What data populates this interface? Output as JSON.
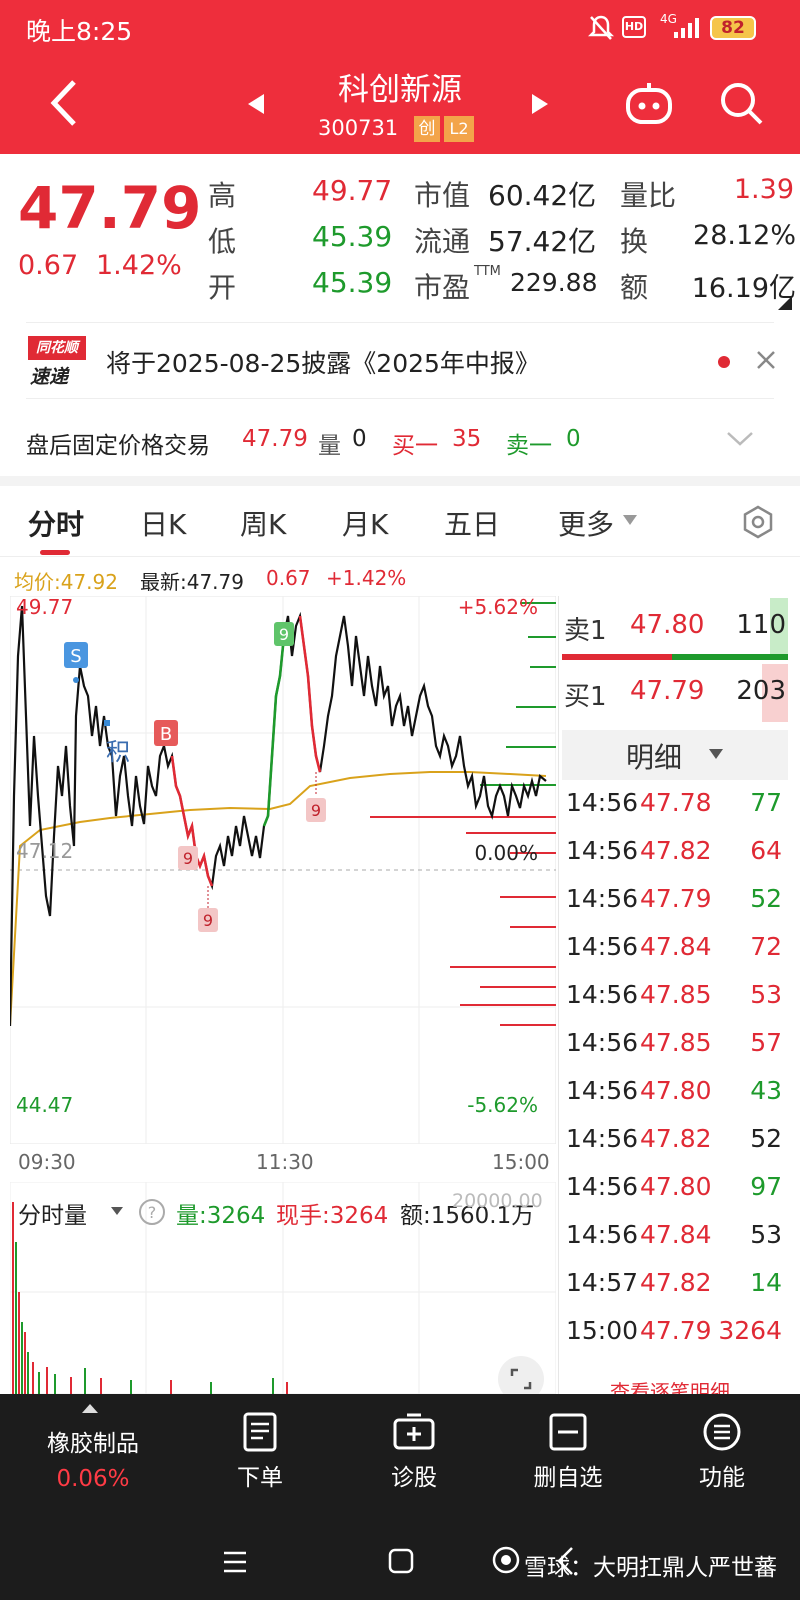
{
  "status": {
    "time": "晚上8:25",
    "battery": "82",
    "net": "4G",
    "hd": "HD"
  },
  "header": {
    "title": "科创新源",
    "code": "300731",
    "tag1": "创",
    "tag2": "L2"
  },
  "quote": {
    "price": "47.79",
    "change": "0.67",
    "pct": "1.42%",
    "labels": {
      "high": "高",
      "low": "低",
      "open": "开",
      "mcap": "市值",
      "float": "流通",
      "pe": "市盈",
      "pe_sup": "TTM",
      "vr": "量比",
      "turn": "换",
      "amt": "额"
    },
    "high": "49.77",
    "low": "45.39",
    "open": "45.39",
    "mcap": "60.42亿",
    "float": "57.42亿",
    "pe": "229.88",
    "vr": "1.39",
    "turn": "28.12%",
    "amt": "16.19亿"
  },
  "notice": {
    "logo1": "同花顺",
    "logo2": "速递",
    "text": "将于2025-08-25披露《2025年中报》"
  },
  "after": {
    "label": "盘后固定价格交易",
    "price": "47.79",
    "vol_label": "量",
    "vol": "0",
    "buy_label": "买一",
    "buy": "35",
    "sell_label": "卖一",
    "sell": "0"
  },
  "tabs": [
    "分时",
    "日K",
    "周K",
    "月K",
    "五日",
    "更多"
  ],
  "chartinfo": {
    "avg": "均价:47.92",
    "latest": "最新:47.79",
    "chg": "0.67",
    "pct": "+1.42%"
  },
  "chart": {
    "ymax": "49.77",
    "ymin": "44.47",
    "pmax": "+5.62%",
    "pmin": "-5.62%",
    "base": "47.12",
    "pbase": "0.00%",
    "t1": "09:30",
    "t2": "11:30",
    "t3": "15:00",
    "markS": "S",
    "markB": "B",
    "mark9": "9",
    "markJi": "积",
    "colors": {
      "price": "#111111",
      "avg": "#d9a21b",
      "up": "#e02a35",
      "down": "#1e9a2c"
    }
  },
  "volbar": {
    "label": "分时量",
    "vol": "量:3264",
    "hand": "现手:3264",
    "amt": "额:1560.1万",
    "ghost": "20000.00"
  },
  "orderbook": {
    "sell_label": "卖1",
    "sell_price": "47.80",
    "sell_vol": "110",
    "buy_label": "买1",
    "buy_price": "47.79",
    "buy_vol": "203"
  },
  "detail": {
    "title": "明细",
    "more": "查看逐笔明细",
    "rows": [
      {
        "t": "14:56",
        "p": "47.78",
        "v": "77",
        "c": "green"
      },
      {
        "t": "14:56",
        "p": "47.82",
        "v": "64",
        "c": "red"
      },
      {
        "t": "14:56",
        "p": "47.79",
        "v": "52",
        "c": "green"
      },
      {
        "t": "14:56",
        "p": "47.84",
        "v": "72",
        "c": "red"
      },
      {
        "t": "14:56",
        "p": "47.85",
        "v": "53",
        "c": "red"
      },
      {
        "t": "14:56",
        "p": "47.85",
        "v": "57",
        "c": "red"
      },
      {
        "t": "14:56",
        "p": "47.80",
        "v": "43",
        "c": "green"
      },
      {
        "t": "14:56",
        "p": "47.82",
        "v": "52",
        "c": "black"
      },
      {
        "t": "14:56",
        "p": "47.80",
        "v": "97",
        "c": "green"
      },
      {
        "t": "14:56",
        "p": "47.84",
        "v": "53",
        "c": "black"
      },
      {
        "t": "14:57",
        "p": "47.82",
        "v": "14",
        "c": "green"
      },
      {
        "t": "15:00",
        "p": "47.79",
        "v": "3264",
        "c": "red"
      }
    ]
  },
  "bottom": {
    "sector": "橡胶制品",
    "sector_pct": "0.06%",
    "order": "下单",
    "diag": "诊股",
    "del": "删自选",
    "func": "功能"
  },
  "watermark": "雪球：大明扛鼎人严世蕃"
}
